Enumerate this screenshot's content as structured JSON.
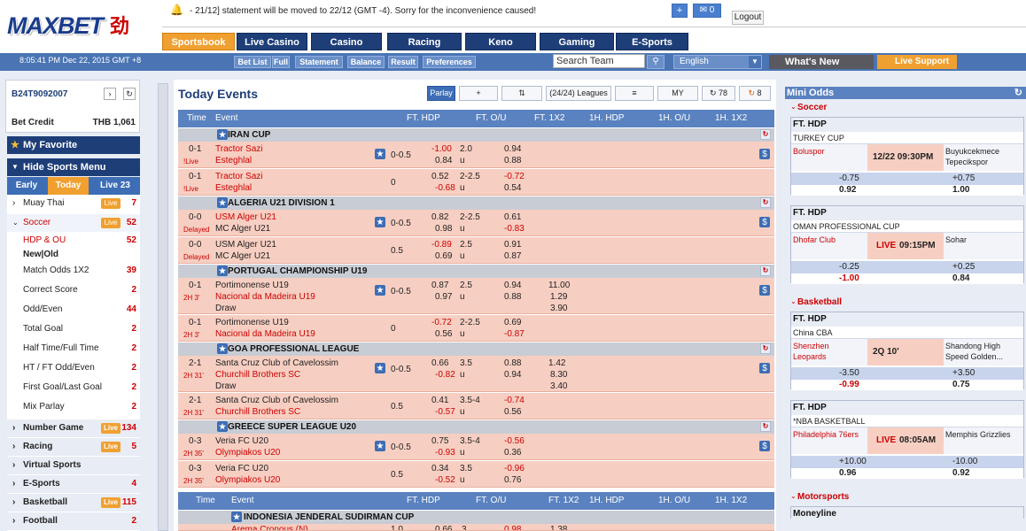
{
  "brand": {
    "logo_text": "MAXBET",
    "logo_suffix": "劲"
  },
  "notice": "- 21/12] statement will be moved to 22/12 (GMT -4). Sorry for the inconvenience caused!",
  "header": {
    "plus_label": "+",
    "msg_label": "✉ 0",
    "logout_label": "Logout"
  },
  "tabs": [
    "Sportsbook",
    "Live Casino",
    "Casino",
    "Racing",
    "Keno",
    "Gaming",
    "E-Sports"
  ],
  "navbar": {
    "datetime": "8:05:41 PM Dec 22, 2015 GMT +8",
    "links": [
      "Bet List",
      "Full",
      "Statement",
      "Balance",
      "Result",
      "Preferences"
    ],
    "search_placeholder": "Search Team",
    "language": "English",
    "whats_new": "What's New",
    "live_support": "Live Support"
  },
  "account": {
    "id": "B24T9092007",
    "bet_credit_label": "Bet Credit",
    "bet_credit": "THB 1,061"
  },
  "sidebar": {
    "favorite": "My Favorite",
    "hide_menu": "Hide Sports Menu",
    "mode_tabs": [
      "Early",
      "Today",
      "Live 23"
    ],
    "sports": [
      {
        "name": "Muay Thai",
        "live": "Live",
        "count": "7"
      },
      {
        "name": "Soccer",
        "live": "Live",
        "count": "52"
      },
      {
        "name": "HDP & OU",
        "count": "52"
      },
      {
        "name": "New|Old"
      },
      {
        "name": "Match Odds 1X2",
        "count": "39"
      },
      {
        "name": "Correct Score",
        "count": "2"
      },
      {
        "name": "Odd/Even",
        "count": "44"
      },
      {
        "name": "Total Goal",
        "count": "2"
      },
      {
        "name": "Half Time/Full Time",
        "count": "2"
      },
      {
        "name": "HT / FT Odd/Even",
        "count": "2"
      },
      {
        "name": "First Goal/Last Goal",
        "count": "2"
      },
      {
        "name": "Mix Parlay",
        "count": "2"
      },
      {
        "name": "Number Game",
        "live": "Live",
        "count": "134"
      },
      {
        "name": "Racing",
        "live": "Live",
        "count": "5"
      },
      {
        "name": "Virtual Sports"
      },
      {
        "name": "E-Sports",
        "count": "4"
      },
      {
        "name": "Basketball",
        "live": "Live",
        "count": "115"
      },
      {
        "name": "Football",
        "count": "2"
      }
    ]
  },
  "main": {
    "title": "Today Events",
    "toolbar": {
      "parlay": "Parlay",
      "add": "+",
      "sort": "⇅",
      "leagues": "(24/24) Leagues",
      "list": "≡",
      "my": "MY",
      "refresh_count": "78",
      "hot_count": "8"
    },
    "columns": [
      "Time",
      "Event",
      "FT. HDP",
      "FT. O/U",
      "FT. 1X2",
      "1H. HDP",
      "1H. O/U",
      "1H. 1X2"
    ],
    "leagues": [
      {
        "name": "IRAN CUP",
        "events": [
          {
            "score": "0-1",
            "status": "!Live",
            "home": "Tractor Sazi",
            "away": "Esteghlal",
            "hdp_line": "0-0.5",
            "hdp_home": "-1.00",
            "hdp_away": "0.84",
            "ou_line": "2.0",
            "ou_u": "u",
            "ou_over": "0.94",
            "ou_under": "0.88",
            "draw": ""
          },
          {
            "score": "0-1",
            "status": "!Live",
            "home": "Tractor Sazi",
            "away": "Esteghlal",
            "hdp_line": "0",
            "hdp_home": "0.52",
            "hdp_away": "-0.68",
            "ou_line": "2-2.5",
            "ou_u": "u",
            "ou_over": "-0.72",
            "ou_under": "0.54",
            "draw": ""
          }
        ]
      },
      {
        "name": "ALGERIA U21 DIVISION 1",
        "events": [
          {
            "score": "0-0",
            "status": "Delayed",
            "home": "USM Alger U21",
            "away": "MC Alger U21",
            "hdp_line": "0-0.5",
            "hdp_home": "0.82",
            "hdp_away": "0.98",
            "ou_line": "2-2.5",
            "ou_u": "u",
            "ou_over": "0.61",
            "ou_under": "-0.83",
            "draw": ""
          },
          {
            "score": "0-0",
            "status": "Delayed",
            "home": "USM Alger U21",
            "away": "MC Alger U21",
            "hdp_line": "0.5",
            "hdp_home": "-0.89",
            "hdp_away": "0.69",
            "ou_line": "2.5",
            "ou_u": "u",
            "ou_over": "0.91",
            "ou_under": "0.87",
            "draw": ""
          }
        ]
      },
      {
        "name": "PORTUGAL CHAMPIONSHIP U19",
        "events": [
          {
            "score": "0-1",
            "status": "2H 3'",
            "home": "Portimonense U19",
            "away": "Nacional da Madeira U19",
            "hdp_line": "0-0.5",
            "hdp_home": "0.87",
            "hdp_away": "0.97",
            "ou_line": "2.5",
            "ou_u": "u",
            "ou_over": "0.94",
            "ou_under": "0.88",
            "draw": "Draw",
            "x1": "11.00",
            "x2": "1.29",
            "x3": "3.90"
          },
          {
            "score": "0-1",
            "status": "2H 3'",
            "home": "Portimonense U19",
            "away": "Nacional da Madeira U19",
            "hdp_line": "0",
            "hdp_home": "-0.72",
            "hdp_away": "0.56",
            "ou_line": "2-2.5",
            "ou_u": "u",
            "ou_over": "0.69",
            "ou_under": "-0.87",
            "draw": ""
          }
        ]
      },
      {
        "name": "GOA PROFESSIONAL LEAGUE",
        "events": [
          {
            "score": "2-1",
            "status": "2H 31'",
            "home": "Santa Cruz Club of Cavelossim",
            "away": "Churchill Brothers SC",
            "hdp_line": "0-0.5",
            "hdp_home": "0.66",
            "hdp_away": "-0.82",
            "ou_line": "3.5",
            "ou_u": "u",
            "ou_over": "0.88",
            "ou_under": "0.94",
            "draw": "Draw",
            "x1": "1.42",
            "x2": "8.30",
            "x3": "3.40"
          },
          {
            "score": "2-1",
            "status": "2H 31'",
            "home": "Santa Cruz Club of Cavelossim",
            "away": "Churchill Brothers SC",
            "hdp_line": "0.5",
            "hdp_home": "0.41",
            "hdp_away": "-0.57",
            "ou_line": "3.5-4",
            "ou_u": "u",
            "ou_over": "-0.74",
            "ou_under": "0.56",
            "draw": ""
          }
        ]
      },
      {
        "name": "GREECE SUPER LEAGUE U20",
        "events": [
          {
            "score": "0-3",
            "status": "2H 35'",
            "home": "Veria FC U20",
            "away": "Olympiakos U20",
            "hdp_line": "0-0.5",
            "hdp_home": "0.75",
            "hdp_away": "-0.93",
            "ou_line": "3.5-4",
            "ou_u": "u",
            "ou_over": "-0.56",
            "ou_under": "0.36",
            "draw": ""
          },
          {
            "score": "0-3",
            "status": "2H 35'",
            "home": "Veria FC U20",
            "away": "Olympiakos U20",
            "hdp_line": "0.5",
            "hdp_home": "0.34",
            "hdp_away": "-0.52",
            "ou_line": "3.5",
            "ou_u": "u",
            "ou_over": "-0.96",
            "ou_under": "0.76",
            "draw": ""
          }
        ]
      }
    ],
    "second_header_league": "INDONESIA JENDERAL SUDIRMAN CUP",
    "partial_row": {
      "home": "Arema Cronous (N)",
      "hdp_line": "1.0",
      "hdp_home": "0.66",
      "ou_line": "3",
      "ou_over": "0.98",
      "x1": "1.38"
    }
  },
  "mini_odds": {
    "title": "Mini Odds",
    "sections": [
      {
        "sport": "Soccer",
        "boxes": [
          {
            "market": "FT. HDP",
            "league": "TURKEY CUP",
            "home": "Boluspor",
            "away": "Buyukcekmece Tepecikspor",
            "time": "12/22 09:30PM",
            "hdp_home": "-0.75",
            "hdp_away": "+0.75",
            "odds_home": "0.92",
            "odds_away": "1.00"
          },
          {
            "market": "FT. HDP",
            "league": "OMAN PROFESSIONAL CUP",
            "home": "Dhofar Club",
            "away": "Sohar",
            "live": "LIVE",
            "time": "09:15PM",
            "hdp_home": "-0.25",
            "hdp_away": "+0.25",
            "odds_home": "-1.00",
            "odds_away": "0.84"
          }
        ]
      },
      {
        "sport": "Basketball",
        "boxes": [
          {
            "market": "FT. HDP",
            "league": "China CBA",
            "home": "Shenzhen Leopards",
            "away": "Shandong High Speed Golden...",
            "time": "2Q 10'",
            "hdp_home": "-3.50",
            "hdp_away": "+3.50",
            "odds_home": "-0.99",
            "odds_away": "0.75"
          },
          {
            "market": "FT. HDP",
            "league": "*NBA BASKETBALL",
            "home": "Philadelphia 76ers",
            "away": "Memphis Grizzlies",
            "live": "LIVE",
            "time": "08:05AM",
            "hdp_home": "+10.00",
            "hdp_away": "-10.00",
            "odds_home": "0.96",
            "odds_away": "0.92"
          }
        ]
      },
      {
        "sport": "Motorsports",
        "boxes": [
          {
            "market": "Moneyline"
          }
        ]
      }
    ]
  }
}
